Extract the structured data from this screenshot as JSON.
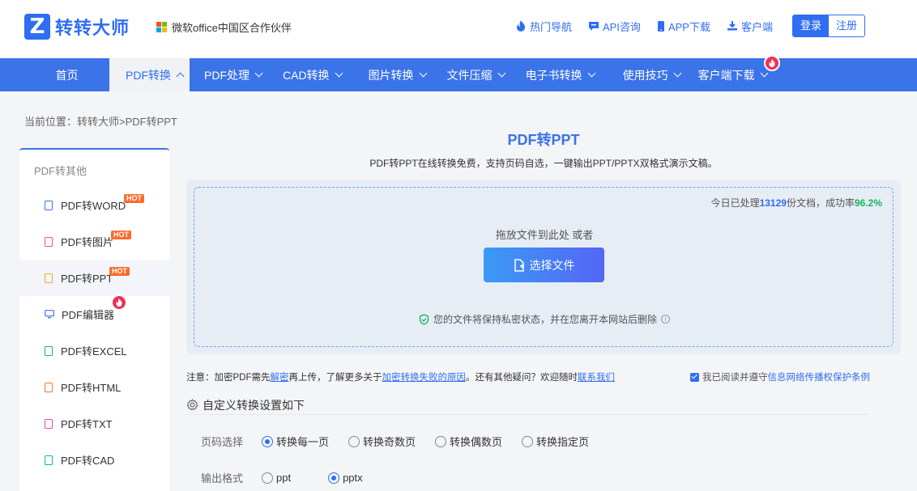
{
  "brand": {
    "name": "转转大师",
    "partner": "微软office中国区合作伙伴"
  },
  "toplinks": [
    {
      "label": "热门导航",
      "icon": "fire-icon"
    },
    {
      "label": "API咨询",
      "icon": "chat-icon"
    },
    {
      "label": "APP下载",
      "icon": "phone-icon"
    },
    {
      "label": "客户端",
      "icon": "download-icon"
    }
  ],
  "auth": {
    "login": "登录",
    "register": "注册"
  },
  "nav": [
    {
      "label": "首页"
    },
    {
      "label": "PDF转换"
    },
    {
      "label": "PDF处理"
    },
    {
      "label": "CAD转换"
    },
    {
      "label": "图片转换"
    },
    {
      "label": "文件压缩"
    },
    {
      "label": "电子书转换"
    },
    {
      "label": "使用技巧"
    },
    {
      "label": "客户端下载"
    }
  ],
  "breadcrumb": "当前位置：转转大师>PDF转PPT",
  "sidebar": {
    "heading": "PDF转其他",
    "items": [
      {
        "label": "PDF转WORD",
        "badge": "HOT",
        "color": "#3b73e8"
      },
      {
        "label": "PDF转图片",
        "badge": "HOT",
        "color": "#f05a5a"
      },
      {
        "label": "PDF转PPT",
        "badge": "HOT",
        "color": "#f5a623"
      },
      {
        "label": "PDF编辑器",
        "badge": "fire",
        "color": "#3b73e8"
      },
      {
        "label": "PDF转EXCEL",
        "badge": "",
        "color": "#19b25d"
      },
      {
        "label": "PDF转HTML",
        "badge": "",
        "color": "#f07a2a"
      },
      {
        "label": "PDF转TXT",
        "badge": "",
        "color": "#e24fa0"
      },
      {
        "label": "PDF转CAD",
        "badge": "",
        "color": "#19b2a5"
      }
    ]
  },
  "main": {
    "title": "PDF转PPT",
    "subtitle": "PDF转PPT在线转换免费，支持页码自选，一键输出PPT/PPTX双格式演示文稿。",
    "stats_prefix": "今日已处理",
    "stats_count": "13129",
    "stats_mid": "份文档，成功率",
    "stats_rate": "96.2%",
    "drop_hint": "拖放文件到此处 或者",
    "choose_button": "选择文件",
    "privacy": "您的文件将保持私密状态，并在您离开本网站后删除"
  },
  "notice": {
    "t1": "注意：加密PDF需先",
    "l1": "解密",
    "t2": "再上传，了解更多关于",
    "l2": "加密转换失败的原因",
    "t3": "。还有其他疑问？欢迎随时",
    "l3": "联系我们"
  },
  "agree": {
    "t1": "我已阅读并遵守",
    "link": "信息网络传播权保护条例"
  },
  "settings": {
    "heading": "自定义转换设置如下",
    "page_label": "页码选择",
    "page_options": [
      "转换每一页",
      "转换奇数页",
      "转换偶数页",
      "转换指定页"
    ],
    "page_selected": "转换每一页",
    "format_label": "输出格式",
    "format_options": [
      "ppt",
      "pptx"
    ],
    "format_selected": "pptx"
  },
  "colors": {
    "primary": "#3b73e8",
    "success": "#19b25d",
    "hot": "#ff6a2c",
    "fire": "#f03052"
  }
}
